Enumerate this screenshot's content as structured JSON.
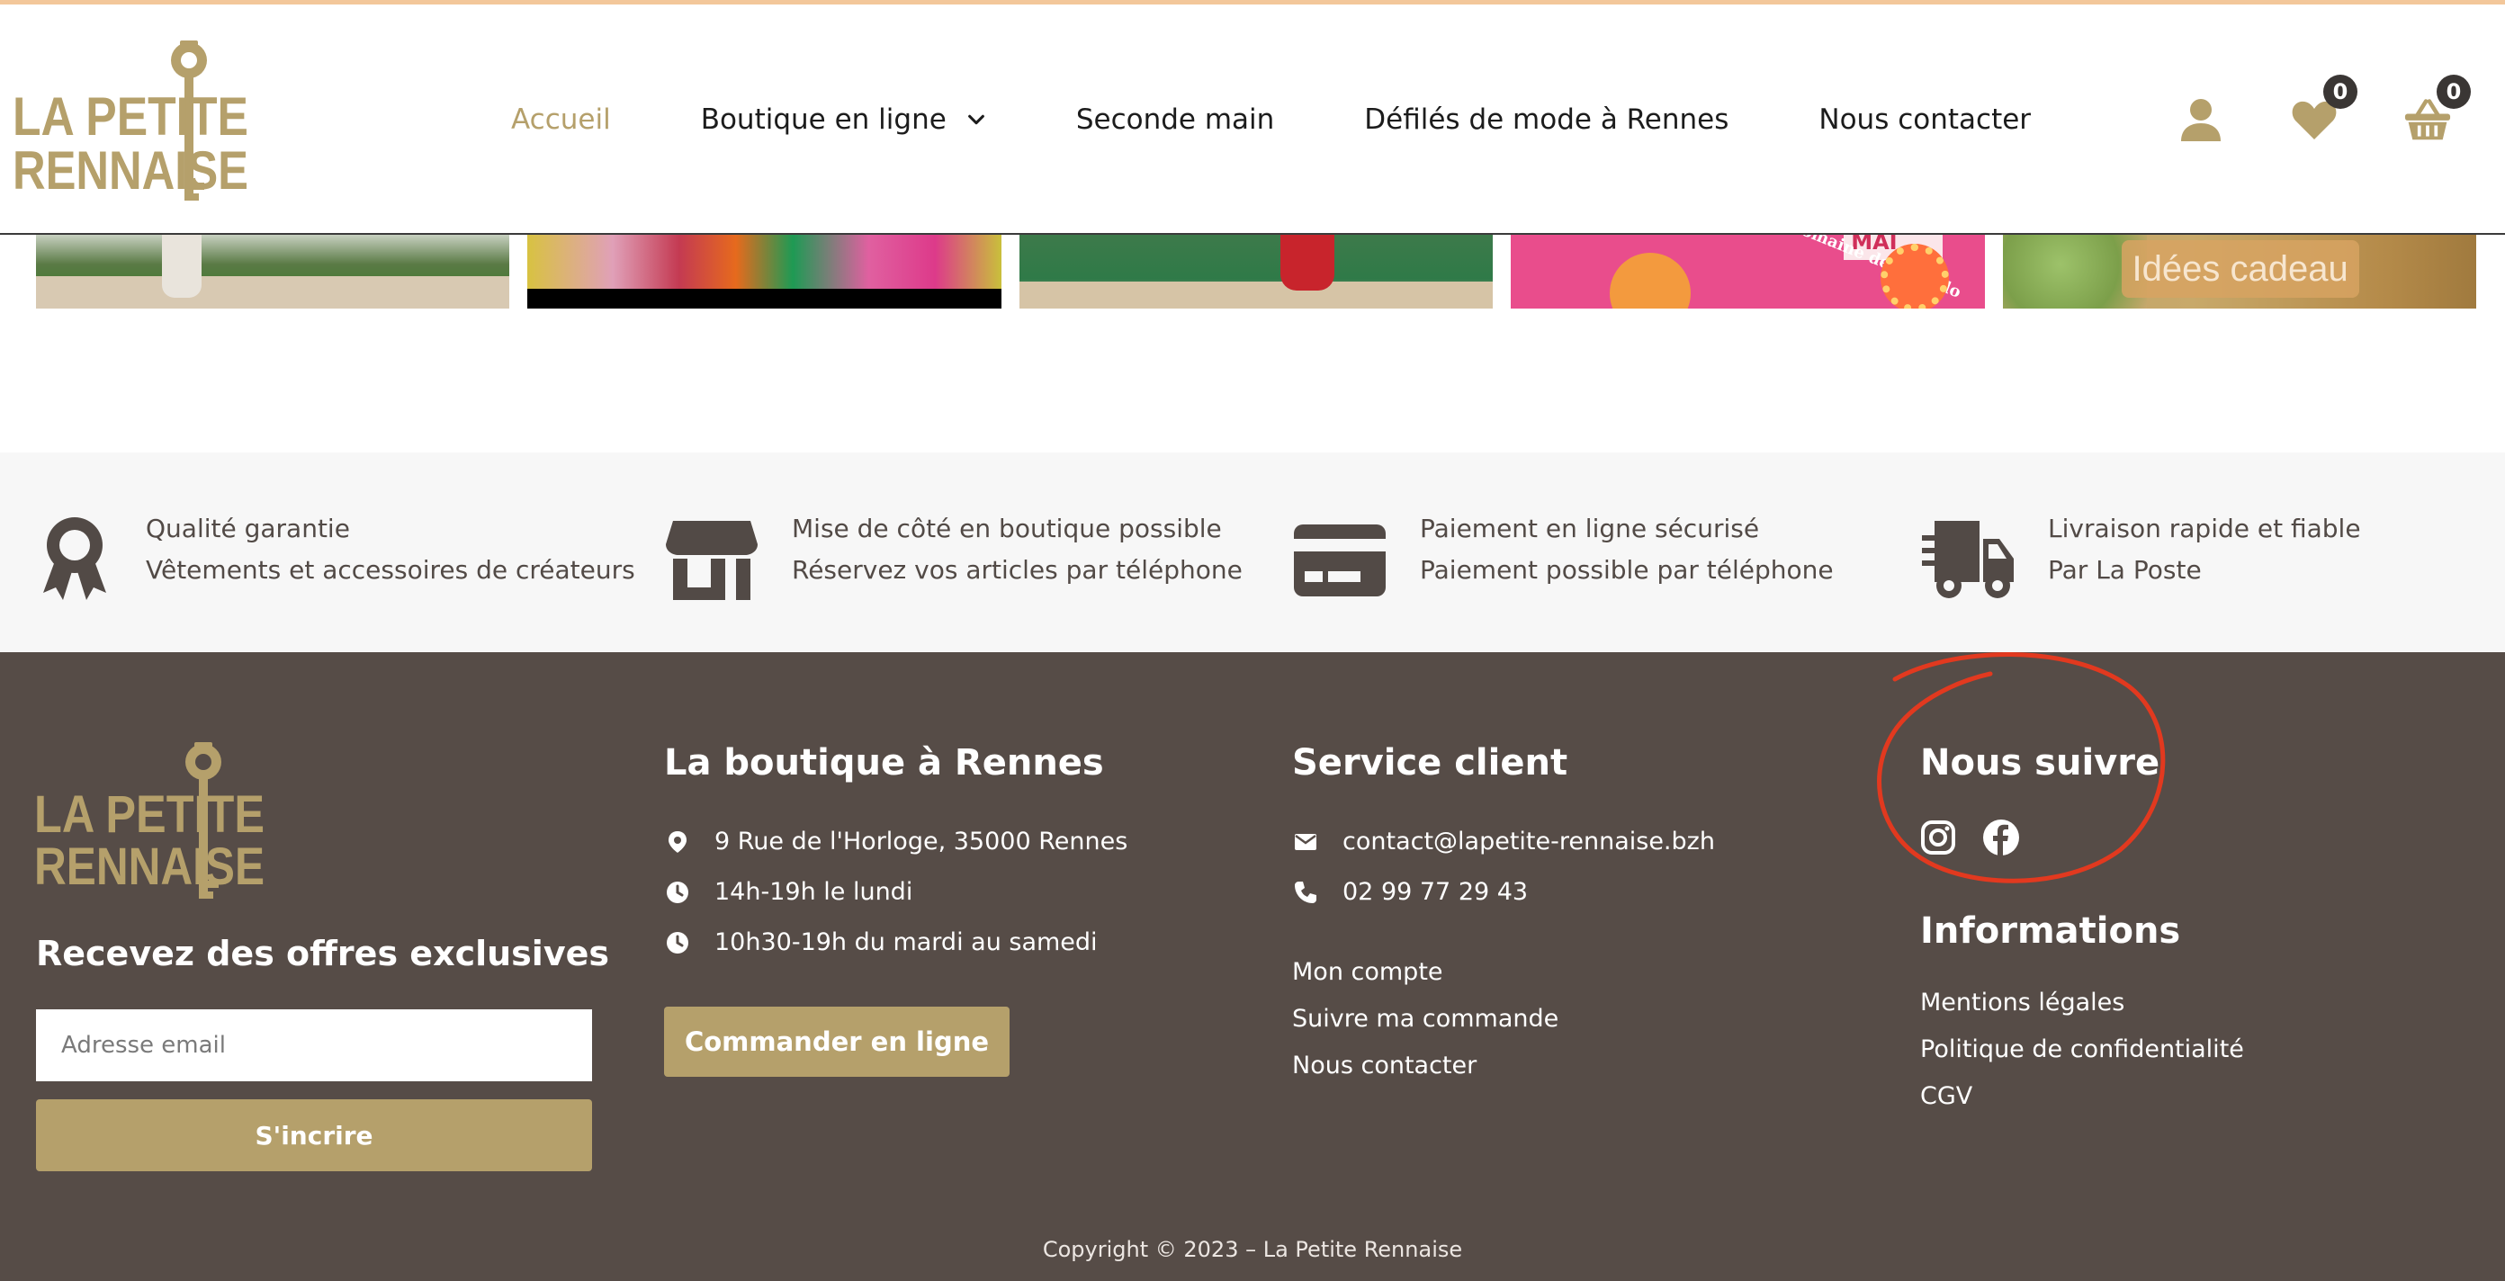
{
  "header": {
    "logo_text_line1": "LA PETITE",
    "logo_text_line2": "RENNAISE",
    "nav": [
      {
        "label": "Accueil",
        "active": true
      },
      {
        "label": "Boutique en ligne",
        "has_dropdown": true
      },
      {
        "label": "Seconde main"
      },
      {
        "label": "Défilés de mode à Rennes"
      },
      {
        "label": "Nous contacter"
      }
    ],
    "icons": {
      "account": "user-icon",
      "wishlist": "heart-icon",
      "cart": "basket-icon"
    },
    "wishlist_count": "0",
    "cart_count": "0"
  },
  "gallery": {
    "items": [
      {
        "icon": "photo-runway-grass"
      },
      {
        "icon": "photo-colorful-dresses"
      },
      {
        "icon": "photo-runway-red-shoes"
      },
      {
        "icon": "photo-flyer",
        "text1": "MAI",
        "text2": "Au Domaine de Océ Blo"
      },
      {
        "icon": "photo-gift-ideas",
        "label": "Idées cadeau"
      }
    ]
  },
  "features": [
    {
      "icon": "award-ribbon-icon",
      "line1": "Qualité garantie",
      "line2": "Vêtements et accessoires de créateurs"
    },
    {
      "icon": "store-icon",
      "line1": "Mise de côté en boutique possible",
      "line2": "Réservez vos articles par téléphone"
    },
    {
      "icon": "credit-card-icon",
      "line1": "Paiement en ligne sécurisé",
      "line2": "Paiement possible par téléphone"
    },
    {
      "icon": "shipping-truck-icon",
      "line1": "Livraison rapide et fiable",
      "line2": "Par La Poste"
    }
  ],
  "footer": {
    "newsletter": {
      "title": "Recevez des offres exclusives",
      "placeholder": "Adresse email",
      "button": "S'incrire"
    },
    "shop": {
      "title": "La boutique à Rennes",
      "address": "9 Rue de l'Horloge, 35000 Rennes",
      "hours1": "14h-19h le lundi",
      "hours2": "10h30-19h du mardi au samedi",
      "button": "Commander en ligne"
    },
    "service": {
      "title": "Service client",
      "email": "contact@lapetite-rennaise.bzh",
      "phone": "02 99 77 29 43",
      "links": [
        "Mon compte",
        "Suivre ma commande",
        "Nous contacter"
      ]
    },
    "follow": {
      "title": "Nous suivre",
      "networks": [
        "instagram-icon",
        "facebook-icon"
      ]
    },
    "informations": {
      "title": "Informations",
      "links": [
        "Mentions légales",
        "Politique de confidentialité",
        "CGV"
      ]
    },
    "copyright": "Copyright © 2023  –  La Petite Rennaise"
  },
  "colors": {
    "gold": "#b5a06b",
    "footer_bg": "#564c47",
    "feature_bg": "#f7f7f7",
    "feature_text": "#524a46",
    "annotation": "#e2391f"
  }
}
